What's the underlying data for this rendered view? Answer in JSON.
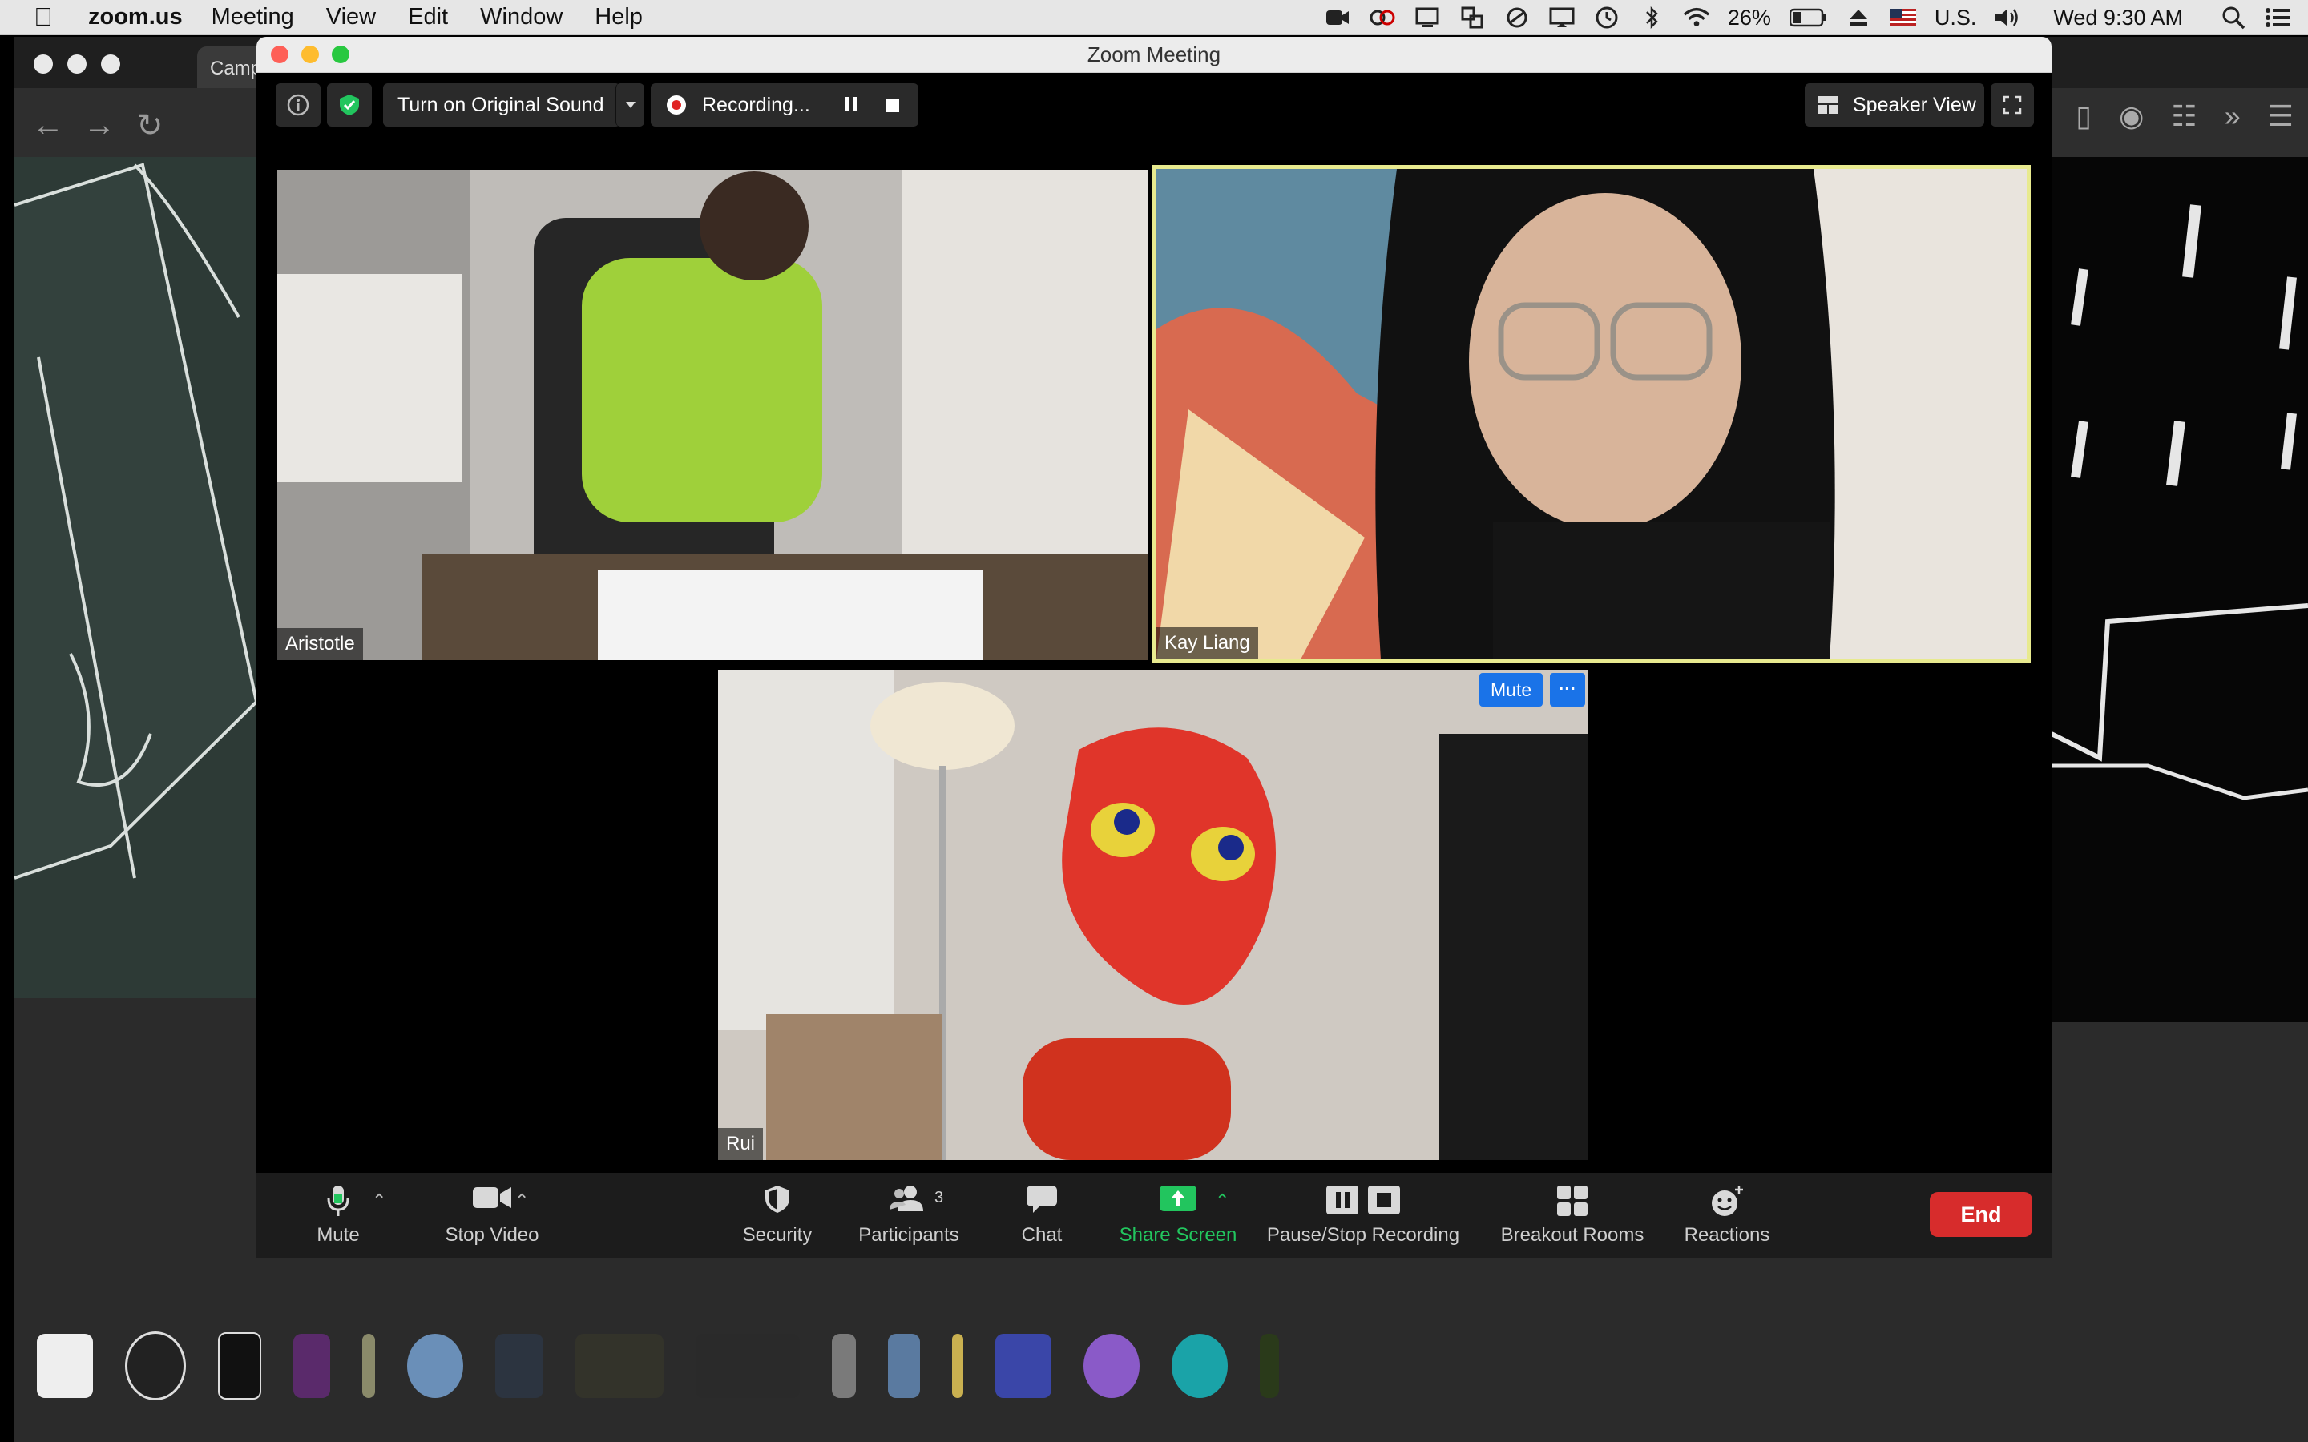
{
  "menubar": {
    "app_name": "zoom.us",
    "items": [
      "Meeting",
      "View",
      "Edit",
      "Window",
      "Help"
    ],
    "battery": "26%",
    "input_source": "U.S.",
    "clock": "Wed 9:30 AM"
  },
  "browser": {
    "tab_label": "Campfi"
  },
  "zoom": {
    "window_title": "Zoom Meeting",
    "original_sound_label": "Turn on Original Sound",
    "recording_label": "Recording...",
    "speaker_view_label": "Speaker View",
    "participants": [
      {
        "name": "Aristotle"
      },
      {
        "name": "Kay Liang"
      },
      {
        "name": "Rui"
      }
    ],
    "tile_mute_label": "Mute",
    "tile_more_label": "···",
    "toolbar": {
      "mute": "Mute",
      "stop_video": "Stop Video",
      "security": "Security",
      "participants": "Participants",
      "participants_count": "3",
      "chat": "Chat",
      "share_screen": "Share Screen",
      "pause_stop_recording": "Pause/Stop Recording",
      "breakout_rooms": "Breakout Rooms",
      "reactions": "Reactions",
      "end": "End"
    }
  },
  "colors": {
    "active_speaker_border": "#e8ea8f",
    "share_green": "#22c55e",
    "end_red": "#d72c2c",
    "zoom_blue": "#1a73e8"
  },
  "icons": [
    "apple-icon",
    "wifi-icon",
    "bluetooth-icon",
    "battery-icon",
    "volume-icon",
    "search-icon",
    "control-center-icon",
    "info-icon",
    "shield-icon",
    "pause-icon",
    "stop-icon",
    "grid-icon",
    "fullscreen-icon",
    "microphone-icon",
    "camera-icon",
    "security-icon",
    "participants-icon",
    "chat-icon",
    "share-screen-icon",
    "breakout-rooms-icon",
    "reactions-icon"
  ]
}
